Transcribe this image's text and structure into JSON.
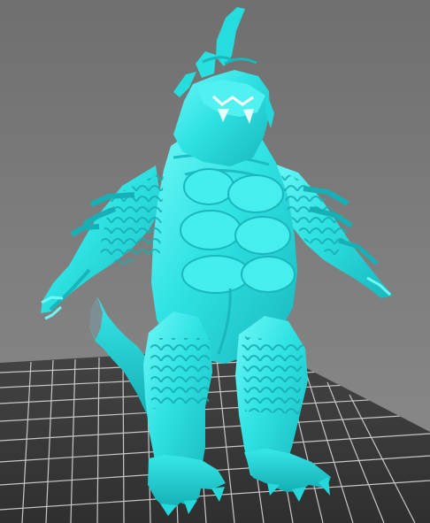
{
  "viewer": {
    "model_color": "#2ee6e6",
    "model_shadow": "#17b8bc",
    "model_highlight": "#7cfbfb",
    "tail_tip_color": "#7d8f92",
    "background_color": "#7a7a7a",
    "grid_color": "#3e3e3e",
    "grid_line_color": "#c8c8c8"
  }
}
